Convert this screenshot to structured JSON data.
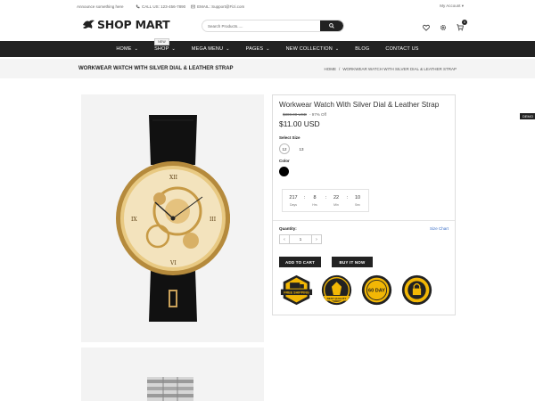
{
  "topbar": {
    "announcement": "Announce something here",
    "phone": "CALL US: 123-456-7890",
    "email": "EMAIL: Support@Fizi.com",
    "account": "My Account"
  },
  "header": {
    "logo_text": "SHOP MART",
    "search_placeholder": "Search Products.....",
    "cart_count": "0"
  },
  "nav": {
    "items": [
      {
        "label": "HOME",
        "chevron": true
      },
      {
        "label": "SHOP",
        "chevron": true,
        "badge": "NEW"
      },
      {
        "label": "MEGA MENU",
        "chevron": true
      },
      {
        "label": "PAGES",
        "chevron": true
      },
      {
        "label": "NEW COLLECTION",
        "chevron": true
      },
      {
        "label": "BLOG",
        "chevron": false
      },
      {
        "label": "CONTACT US",
        "chevron": false
      }
    ]
  },
  "breadcrumb": {
    "page_title": "WORKWEAR WATCH WITH SILVER DIAL & LEATHER STRAP",
    "home": "HOME",
    "separator": "/",
    "current": "WORKWEAR WATCH WITH SILVER DIAL & LEATHER STRAP"
  },
  "product": {
    "title": "Workwear Watch With Silver Dial & Leather Strap",
    "old_price": "$300.00 USD",
    "discount": "- 97% Off",
    "price": "$11.00 USD",
    "size_label": "Select Size",
    "sizes": [
      "12",
      "13"
    ],
    "color_label": "Color",
    "color": "#000000",
    "countdown": [
      {
        "value": "217",
        "unit": "Days"
      },
      {
        "value": "8",
        "unit": "Hrs"
      },
      {
        "value": "22",
        "unit": "Min"
      },
      {
        "value": "10",
        "unit": "Sec"
      }
    ],
    "quantity_label": "Quantity:",
    "size_chart": "Size Chart",
    "quantity": "1",
    "add_to_cart": "ADD TO CART",
    "buy_now": "BUY IT NOW",
    "badges": [
      {
        "name": "free-shipping-badge",
        "text": "FREE SHIPPING"
      },
      {
        "name": "best-quality-badge",
        "text": "BEST QUALITY"
      },
      {
        "name": "money-back-badge",
        "text": "60 DAY"
      },
      {
        "name": "secure-checkout-badge",
        "text": "SECURE"
      }
    ]
  },
  "demo_tab": "DEMO",
  "colors": {
    "nav_bg": "#222222",
    "accent_gold": "#f2b705"
  }
}
